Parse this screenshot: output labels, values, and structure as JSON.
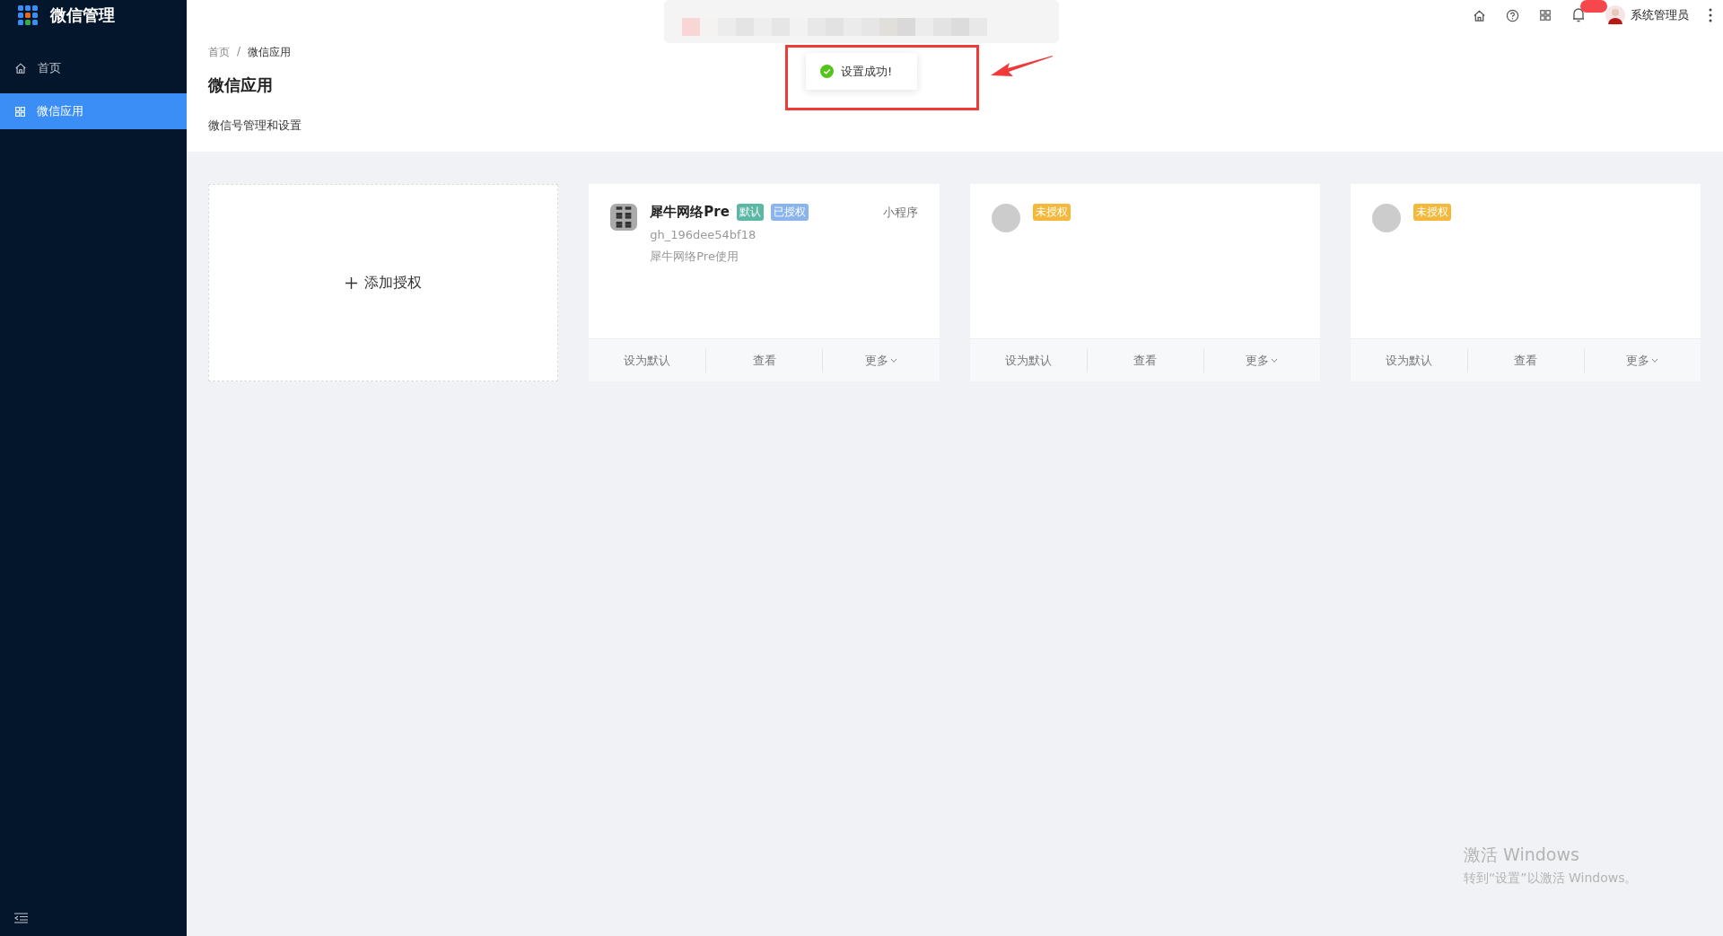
{
  "sidebar": {
    "title": "微信管理",
    "items": [
      {
        "label": "首页",
        "selected": false
      },
      {
        "label": "微信应用",
        "selected": true
      }
    ]
  },
  "header": {
    "user": "系统管理员"
  },
  "toast": {
    "message": "设置成功!"
  },
  "breadcrumb": {
    "items": [
      "首页",
      "微信应用"
    ],
    "separator": "/"
  },
  "page": {
    "title": "微信应用",
    "subtitle": "微信号管理和设置"
  },
  "cards": [
    {
      "kind": "add",
      "label": "添加授权"
    },
    {
      "kind": "authorized",
      "name": "犀牛网络Pre",
      "type": "小程序",
      "id": "gh_196dee54bf18",
      "description": "犀牛网络Pre使用",
      "tags": [
        {
          "label": "默认",
          "color": "#5cb8a4"
        },
        {
          "label": "已授权",
          "color": "#8ab4ee"
        }
      ],
      "actions": [
        "设为默认",
        "查看",
        "更多"
      ]
    },
    {
      "kind": "unauthorized",
      "tags": [
        {
          "label": "未授权",
          "color": "#f4b93a"
        }
      ],
      "actions": [
        "设为默认",
        "查看",
        "更多"
      ]
    },
    {
      "kind": "unauthorized",
      "tags": [
        {
          "label": "未授权",
          "color": "#f4b93a"
        }
      ],
      "actions": [
        "设为默认",
        "查看",
        "更多"
      ]
    }
  ],
  "os_notice": {
    "title": "激活 Windows",
    "text": "转到“设置”以激活 Windows。"
  }
}
